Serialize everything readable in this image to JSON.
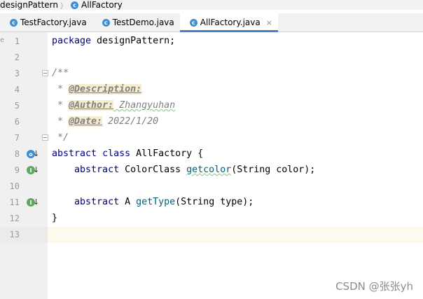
{
  "breadcrumb": {
    "items": [
      {
        "label": "designPattern"
      },
      {
        "label": "AllFactory",
        "icon": "class-icon"
      }
    ],
    "class_icon_letter": "c"
  },
  "tabs": [
    {
      "label": "TestFactory.java",
      "icon": "class-icon",
      "active": false
    },
    {
      "label": "TestDemo.java",
      "icon": "class-icon",
      "active": false
    },
    {
      "label": "AllFactory.java",
      "icon": "class-icon",
      "active": true
    }
  ],
  "tab_close_glyph": "×",
  "editor": {
    "gutter_marker": "e",
    "current_line": 13,
    "lines": [
      {
        "number": "1",
        "keyword": "package",
        "text": " designPattern;"
      },
      {
        "number": "2"
      },
      {
        "number": "3",
        "doc_open": "/**"
      },
      {
        "number": "4",
        "doc_prefix": " * ",
        "tag": "@Description:",
        "rest": ""
      },
      {
        "number": "5",
        "doc_prefix": " * ",
        "tag": "@Author:",
        "rest": " Zhangyuhan"
      },
      {
        "number": "6",
        "doc_prefix": " * ",
        "tag": "@Date:",
        "rest": " 2022/1/20"
      },
      {
        "number": "7",
        "doc_close": " */"
      },
      {
        "number": "8",
        "kw1": "abstract",
        "kw2": "class",
        "rest": " AllFactory {",
        "gutter_icon": "o",
        "gutter_arrow": "↓"
      },
      {
        "number": "9",
        "indent": "    ",
        "kw1": "abstract",
        "type": " ColorClass ",
        "method": "getcolor",
        "args": "(String color);",
        "gutter_icon": "I",
        "gutter_arrow": "↓"
      },
      {
        "number": "10"
      },
      {
        "number": "11",
        "indent": "    ",
        "kw1": "abstract",
        "type": " A ",
        "method": "getType",
        "args": "(String type);",
        "gutter_icon": "I",
        "gutter_arrow": "↓"
      },
      {
        "number": "12",
        "text": "}"
      },
      {
        "number": "13"
      }
    ]
  },
  "watermark": "CSDN @张张yh"
}
